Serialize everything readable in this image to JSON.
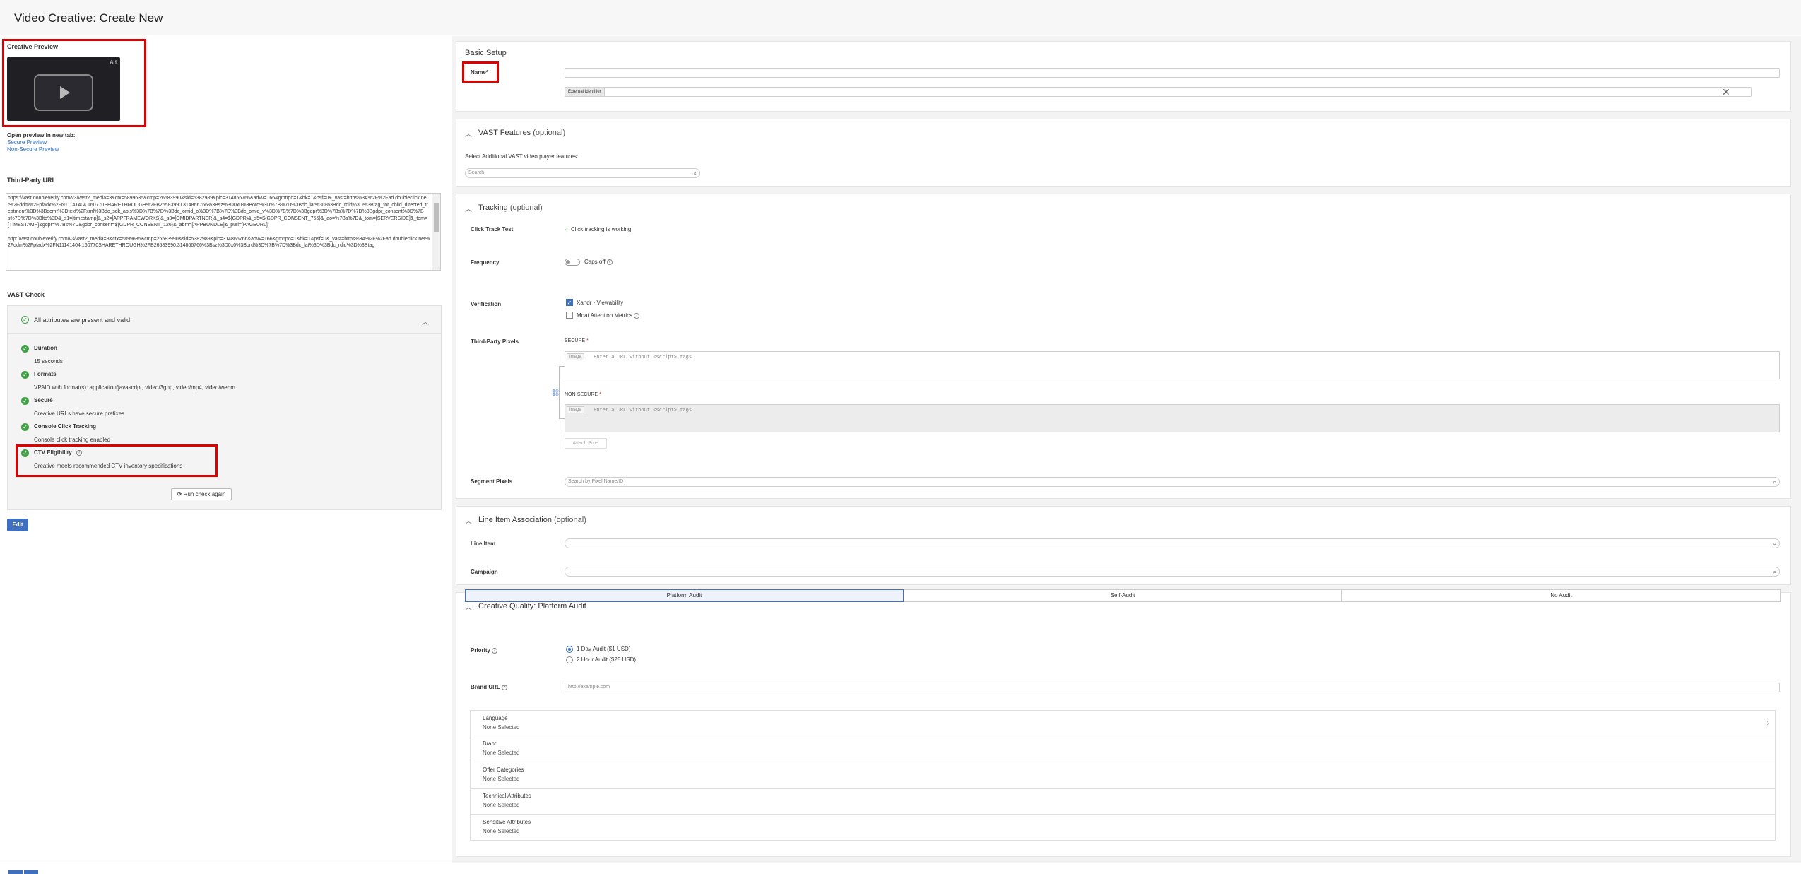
{
  "page": {
    "title": "Video Creative: Create New"
  },
  "left": {
    "creative_preview_label": "Creative Preview",
    "ad_tag": "Ad",
    "open_preview_label": "Open preview in new tab:",
    "secure_preview": "Secure Preview",
    "non_secure_preview": "Non-Secure Preview",
    "third_party_url_label": "Third-Party URL",
    "third_party_url_1": "https://vast.doubleverify.com/v3/vast?_media=3&ctx=5899635&cmp=26583990&sid=5382989&plc=314866766&advv=166&gmnpo=1&bk=1&psf=0&_vast=https%3A%2F%2Fad.doubleclick.net%2Fddm%2Fpfadx%2FN11141404.160770SHARETHROUGH%2FB26583990.314866766%3Bsz%3D0x0%3Bord%3D%7B%7D%3Bdc_lat%3D%3Bdc_rdid%3D%3Btag_for_child_directed_treatment%3D%3Bdcmt%3Dtext%2Fxml%3Bdc_sdk_apis%3D%7B%7D%3Bdc_omid_p%3D%7B%7D%3Bdc_omid_v%3D%7B%7D%3Bgdpr%3D%7Bs%7D%7D%3Bgdpr_consent%3D%7Bs%7D%7D%3Bltd%3D&_s1=[timestamp]&_s2=[APPFRAMEWORKS]&_s3=[OMIDPARTNER]&_s4=${GDPR}&_s5=${GDPR_CONSENT_755}&_ao=%7Bs%7D&_tom=[SERVERSIDE]&_tom=[TIMESTAMP]&gdpr=%7Bs%7D&gdpr_consent=${GDPR_CONSENT_126}&_abm=[APPBUNDLE]&_purl=[PAGEURL]",
    "third_party_url_2": "http://vast.doubleverify.com/v3/vast?_media=3&ctx=5899635&cmp=26583990&sid=5382989&plc=314866766&advv=166&gmnpo=1&bk=1&psf=0&_vast=https%3A%2F%2Fad.doubleclick.net%2Fddm%2Fpfadx%2FN11141404.160770SHARETHROUGH%2FB26583990.314866766%3Bsz%3D0x0%3Bord%3D%7B%7D%3Bdc_lat%3D%3Bdc_rdid%3D%3Btag",
    "vast_check_label": "VAST Check",
    "vast_summary": "All attributes are present and valid.",
    "checks": [
      {
        "title": "Duration",
        "desc": "15 seconds"
      },
      {
        "title": "Formats",
        "desc": "VPAID with format(s): application/javascript, video/3gpp, video/mp4, video/webm"
      },
      {
        "title": "Secure",
        "desc": "Creative URLs have secure prefixes"
      },
      {
        "title": "Console Click Tracking",
        "desc": "Console click tracking enabled"
      },
      {
        "title": "CTV Eligibility",
        "desc": "Creative meets recommended CTV inventory specifications"
      }
    ],
    "run_check": "Run check again",
    "edit": "Edit"
  },
  "basic_setup": {
    "title": "Basic Setup",
    "name_label": "Name*",
    "external_id": "External Identifier"
  },
  "vast_features": {
    "title": "VAST Features",
    "optional": "(optional)",
    "subtitle": "Select Additional VAST video player features:",
    "search_placeholder": "Search"
  },
  "tracking": {
    "title": "Tracking",
    "optional": "(optional)",
    "click_track_label": "Click Track Test",
    "click_track_status": "Click tracking is working.",
    "frequency_label": "Frequency",
    "caps_off": "Caps off",
    "verification_label": "Verification",
    "xandr": "Xandr - Viewability",
    "moat": "Moat Attention Metrics",
    "tpp_label": "Third-Party Pixels",
    "secure": "SECURE",
    "non_secure": "NON-SECURE",
    "px_type": "Image",
    "px_placeholder": "Enter a URL without <script> tags",
    "attach_pixel": "Attach Pixel",
    "segment_label": "Segment Pixels",
    "segment_placeholder": "Search by Pixel Name/ID"
  },
  "line_item": {
    "title": "Line Item Association",
    "optional": "(optional)",
    "line_item_label": "Line Item",
    "campaign_label": "Campaign"
  },
  "quality": {
    "title": "Creative Quality: Platform Audit",
    "tabs": [
      "Platform Audit",
      "Self-Audit",
      "No Audit"
    ],
    "priority_label": "Priority",
    "opt1": "1 Day Audit ($1 USD)",
    "opt2": "2 Hour Audit ($25 USD)",
    "brand_url_label": "Brand URL",
    "brand_url_placeholder": "http://example.com",
    "accordion": [
      {
        "title": "Language",
        "value": "None Selected"
      },
      {
        "title": "Brand",
        "value": "None Selected"
      },
      {
        "title": "Offer Categories",
        "value": "None Selected"
      },
      {
        "title": "Technical Attributes",
        "value": "None Selected"
      },
      {
        "title": "Sensitive Attributes",
        "value": "None Selected"
      }
    ]
  }
}
